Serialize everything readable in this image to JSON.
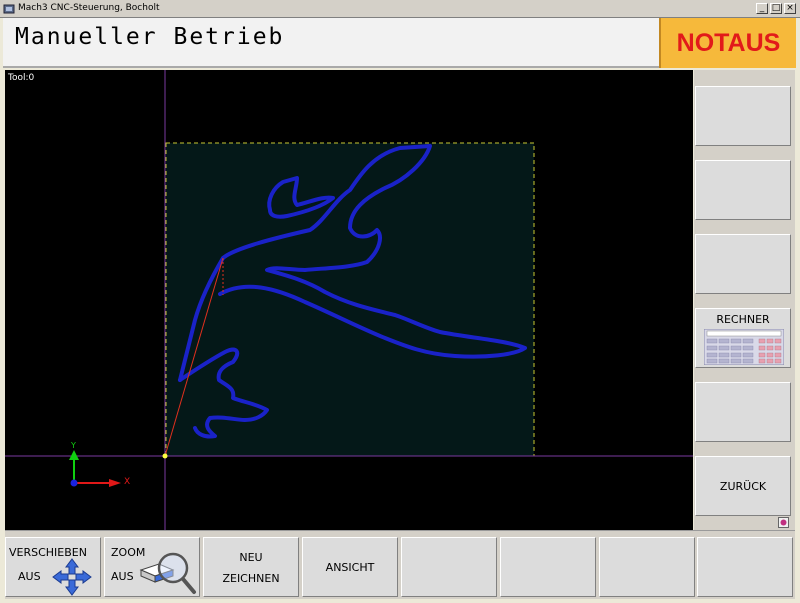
{
  "window": {
    "title": "Mach3 CNC-Steuerung, Bocholt",
    "buttons": [
      "_",
      "□",
      "×"
    ]
  },
  "header": {
    "mode_title": "Manueller Betrieb",
    "emergency_label": "NOTAUS",
    "emergency_color": "#e21a1a"
  },
  "viewport": {
    "tool_label": "Tool:0",
    "axis_labels": {
      "y": "Y",
      "x": "X"
    },
    "accent_colors": {
      "path": "#1a22c8",
      "extent": "#c8c832",
      "plunge": "#e0301e"
    }
  },
  "right_panel": {
    "buttons": [
      {
        "label": ""
      },
      {
        "label": ""
      },
      {
        "label": ""
      },
      {
        "label": "RECHNER",
        "icon": "calculator-icon"
      },
      {
        "label": ""
      },
      {
        "label": "ZURÜCK"
      }
    ]
  },
  "bottom_bar": {
    "buttons": [
      {
        "line1": "VERSCHIEBEN",
        "line2": "AUS",
        "icon": "move-arrows-icon"
      },
      {
        "line1": "ZOOM",
        "line2": "AUS",
        "icon": "zoom-magnifier-icon"
      },
      {
        "line1": "NEU",
        "line2": "ZEICHNEN"
      },
      {
        "line1": "ANSICHT"
      },
      {
        "line1": ""
      },
      {
        "line1": ""
      },
      {
        "line1": ""
      },
      {
        "line1": ""
      }
    ]
  }
}
